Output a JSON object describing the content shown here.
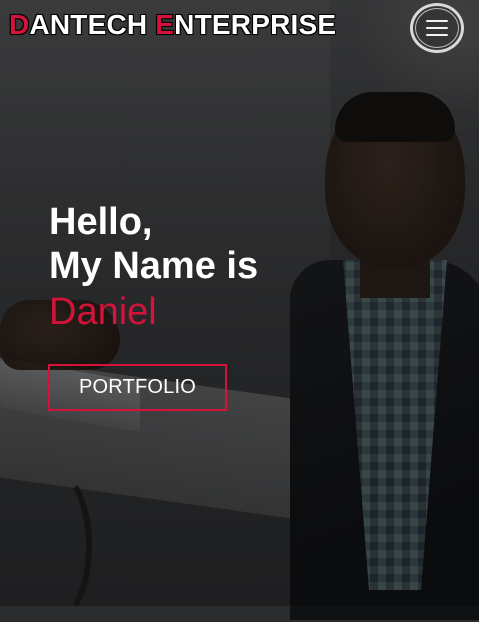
{
  "header": {
    "brand": {
      "first_letter_1": "D",
      "rest_1": "ANTECH",
      "first_letter_2": "E",
      "rest_2": "NTERPRISE"
    },
    "menu_icon": "hamburger-icon"
  },
  "hero": {
    "greeting": "Hello,",
    "intro": "My Name is",
    "name": "Daniel",
    "cta_label": "PORTFOLIO"
  },
  "colors": {
    "accent": "#d4123a",
    "text": "#ffffff"
  }
}
